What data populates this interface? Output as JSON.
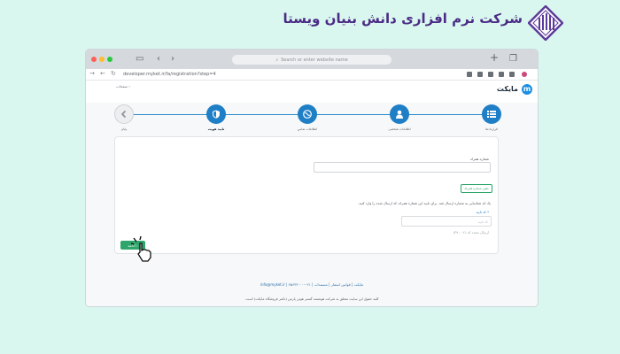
{
  "brand": {
    "title": "شرکت نرم افزاری دانش بنیان ویستا",
    "logo_icon": "vista-building-logo-icon",
    "color": "#4b2b86"
  },
  "browser": {
    "search_placeholder": "Search or enter website name",
    "url": "developer.myket.ir/fa/registration?step=4",
    "icons": [
      "sidebar-icon",
      "back-icon",
      "forward-icon",
      "add-tab-icon",
      "tabs-icon",
      "star-icon",
      "share-icon",
      "reload-icon",
      "extension-icon"
    ]
  },
  "app": {
    "logo_letter": "m",
    "logo_text": "مایکت",
    "back_link": "‹ صفحات",
    "accent": "#1f7fc6",
    "green": "#2ea56a"
  },
  "steps": [
    {
      "label": "قراردادها",
      "icon": "list-icon",
      "state": "done"
    },
    {
      "label": "اطلاعات شخصی",
      "icon": "user-icon",
      "state": "done"
    },
    {
      "label": "اطلاعات تماس",
      "icon": "globe-icon",
      "state": "done"
    },
    {
      "label": "تایید هویت",
      "icon": "shield-icon",
      "state": "active"
    },
    {
      "label": "پایان",
      "icon": "chevron-left-icon",
      "state": "pending"
    }
  ],
  "form": {
    "phone_label": "شماره همراه",
    "phone_value": "",
    "change_button": "تغییر شماره همراه",
    "sms_message": "یک کد شناسایی به شماره            ارسال شد. برای تایید این شماره همراه، کد ارسال شده را وارد کنید.",
    "code_label": "* کد تایید",
    "code_placeholder": "کد تایید",
    "resend_text": "ارسال مجدد کد (۰۲ : ۳۹)",
    "confirm_button": "ادامه ›"
  },
  "footer": {
    "links": "مایکت  |  قوانین انتشار  |  مستندات   |   ۰۲۱-۴۵۶۳۲۰۰۰   |   info@myket.ir",
    "copyright": "کلیه حقوق این سایت متعلق به شرکت هوشمند گستر هوتن پارس (ناشر فروشگاه مایکت) است."
  }
}
